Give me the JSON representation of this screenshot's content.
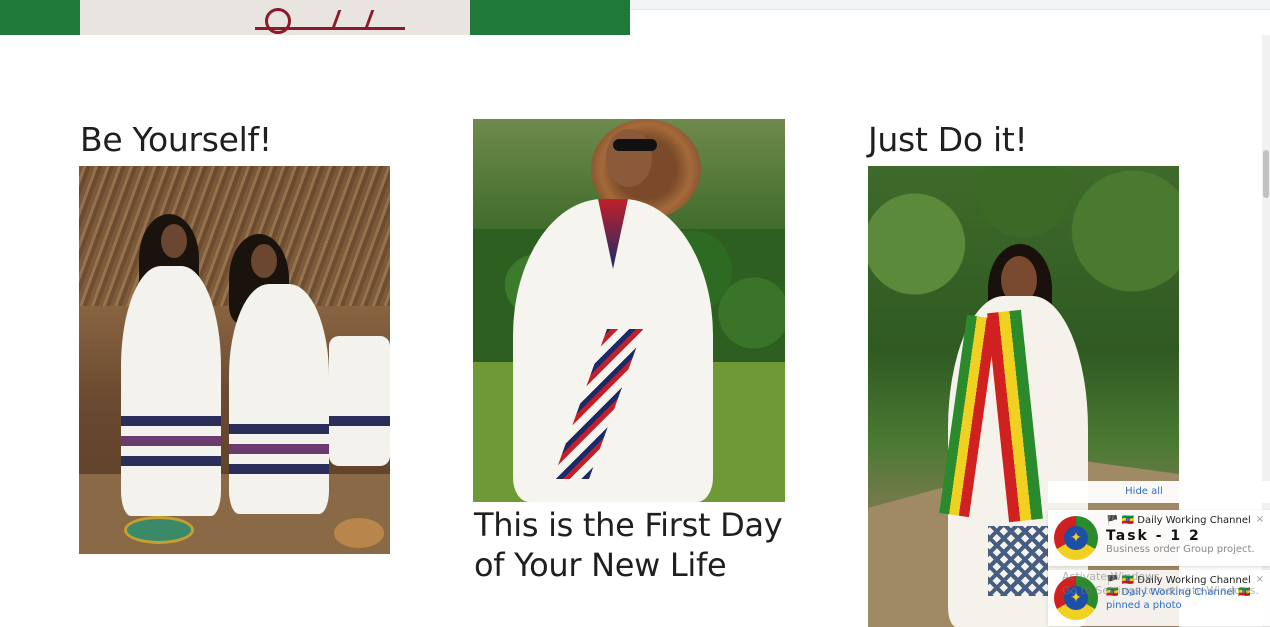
{
  "sections": [
    {
      "heading": "Be Yourself!"
    },
    {
      "heading": "This is the First Day of Your New Life"
    },
    {
      "heading": "Just Do it!"
    }
  ],
  "notifications": {
    "hide_all_label": "Hide all",
    "items": [
      {
        "title": "🏴 🇪🇹 Daily Working Channel ...",
        "headline": "Task - 1 2",
        "preview": "Business order Group project...",
        "close": "×"
      },
      {
        "title": "🏴 🇪🇹 Daily Working Channel ...",
        "preview": "🇪🇹 Daily Working Channel 🇪🇹 pinned a photo",
        "close": "×"
      }
    ]
  },
  "watermark": {
    "line1": "Activate Windows",
    "line2": "Go to Settings to activate Windows."
  },
  "colors": {
    "flag_green": "#2b8a2b",
    "flag_yellow": "#f0d020",
    "flag_red": "#d02020",
    "link_blue": "#2a6fc9"
  }
}
